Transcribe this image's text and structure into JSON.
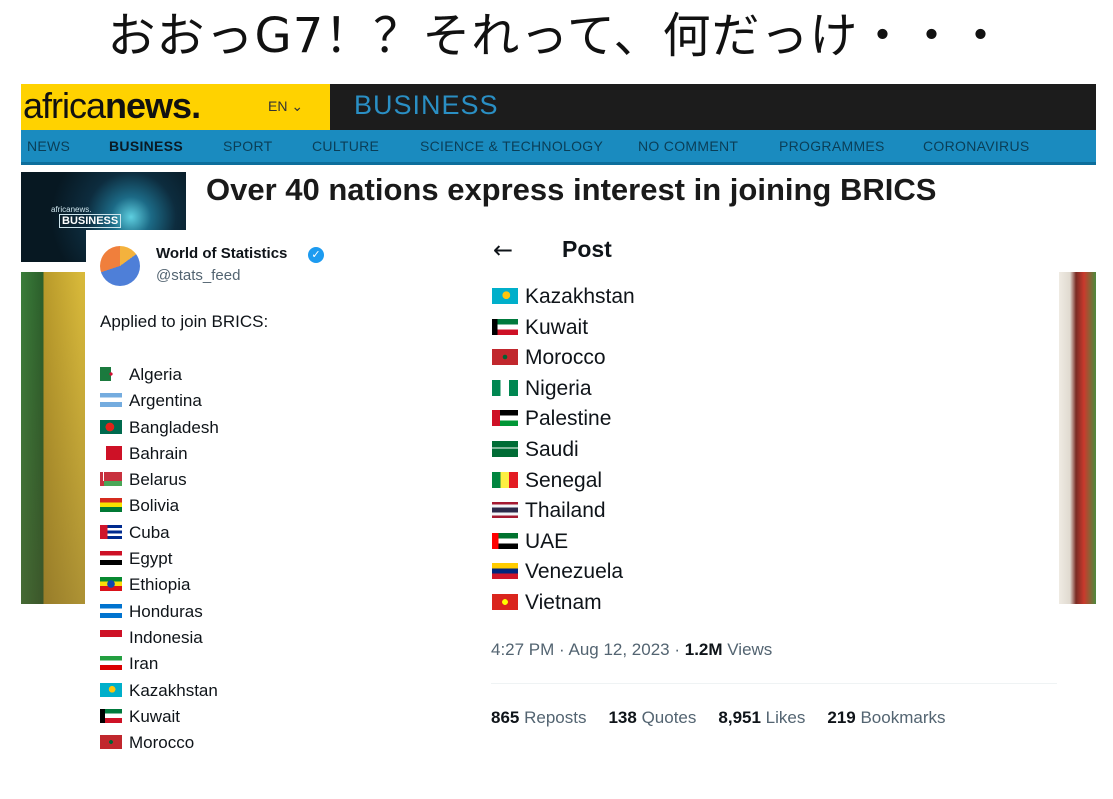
{
  "headline": "おおっG7！？それって、何だっけ・・・",
  "africanews": {
    "logo_light": "africa",
    "logo_bold": "news.",
    "lang": "EN ⌄",
    "section": "BUSINESS",
    "nav": [
      "NEWS",
      "BUSINESS",
      "SPORT",
      "CULTURE",
      "SCIENCE & TECHNOLOGY",
      "NO COMMENT",
      "PROGRAMMES",
      "CORONAVIRUS"
    ],
    "thumb_small": "africanews.",
    "thumb_label": "BUSINESS",
    "article_title": "Over 40 nations express interest in joining BRICS"
  },
  "tweet_left": {
    "name": "World of Statistics",
    "handle": "@stats_feed",
    "intro": "Applied to join BRICS:",
    "countries": [
      {
        "name": "Algeria",
        "flag": "algeria"
      },
      {
        "name": "Argentina",
        "flag": "argentina"
      },
      {
        "name": "Bangladesh",
        "flag": "bangladesh"
      },
      {
        "name": "Bahrain",
        "flag": "bahrain"
      },
      {
        "name": "Belarus",
        "flag": "belarus"
      },
      {
        "name": "Bolivia",
        "flag": "bolivia"
      },
      {
        "name": "Cuba",
        "flag": "cuba"
      },
      {
        "name": "Egypt",
        "flag": "egypt"
      },
      {
        "name": "Ethiopia",
        "flag": "ethiopia"
      },
      {
        "name": "Honduras",
        "flag": "honduras"
      },
      {
        "name": "Indonesia",
        "flag": "indonesia"
      },
      {
        "name": "Iran",
        "flag": "iran"
      },
      {
        "name": "Kazakhstan",
        "flag": "kazakhstan"
      },
      {
        "name": "Kuwait",
        "flag": "kuwait"
      },
      {
        "name": "Morocco",
        "flag": "morocco"
      }
    ]
  },
  "tweet_right": {
    "header": "Post",
    "countries": [
      {
        "name": "Kazakhstan",
        "flag": "kazakhstan"
      },
      {
        "name": "Kuwait",
        "flag": "kuwait"
      },
      {
        "name": "Morocco",
        "flag": "morocco"
      },
      {
        "name": "Nigeria",
        "flag": "nigeria"
      },
      {
        "name": "Palestine",
        "flag": "palestine"
      },
      {
        "name": "Saudi",
        "flag": "saudi"
      },
      {
        "name": "Senegal",
        "flag": "senegal"
      },
      {
        "name": "Thailand",
        "flag": "thailand"
      },
      {
        "name": "UAE",
        "flag": "uae"
      },
      {
        "name": "Venezuela",
        "flag": "venezuela"
      },
      {
        "name": "Vietnam",
        "flag": "vietnam"
      }
    ],
    "timestamp": "4:27 PM · Aug 12, 2023 · ",
    "views_count": "1.2M",
    "views_label": " Views",
    "stats": [
      {
        "count": "865",
        "label": "Reposts"
      },
      {
        "count": "138",
        "label": "Quotes"
      },
      {
        "count": "8,951",
        "label": "Likes"
      },
      {
        "count": "219",
        "label": "Bookmarks"
      }
    ]
  },
  "colors": {
    "brand_yellow": "#ffd200",
    "nav_blue": "#1a8bbf",
    "verified_blue": "#1d9bf0"
  }
}
